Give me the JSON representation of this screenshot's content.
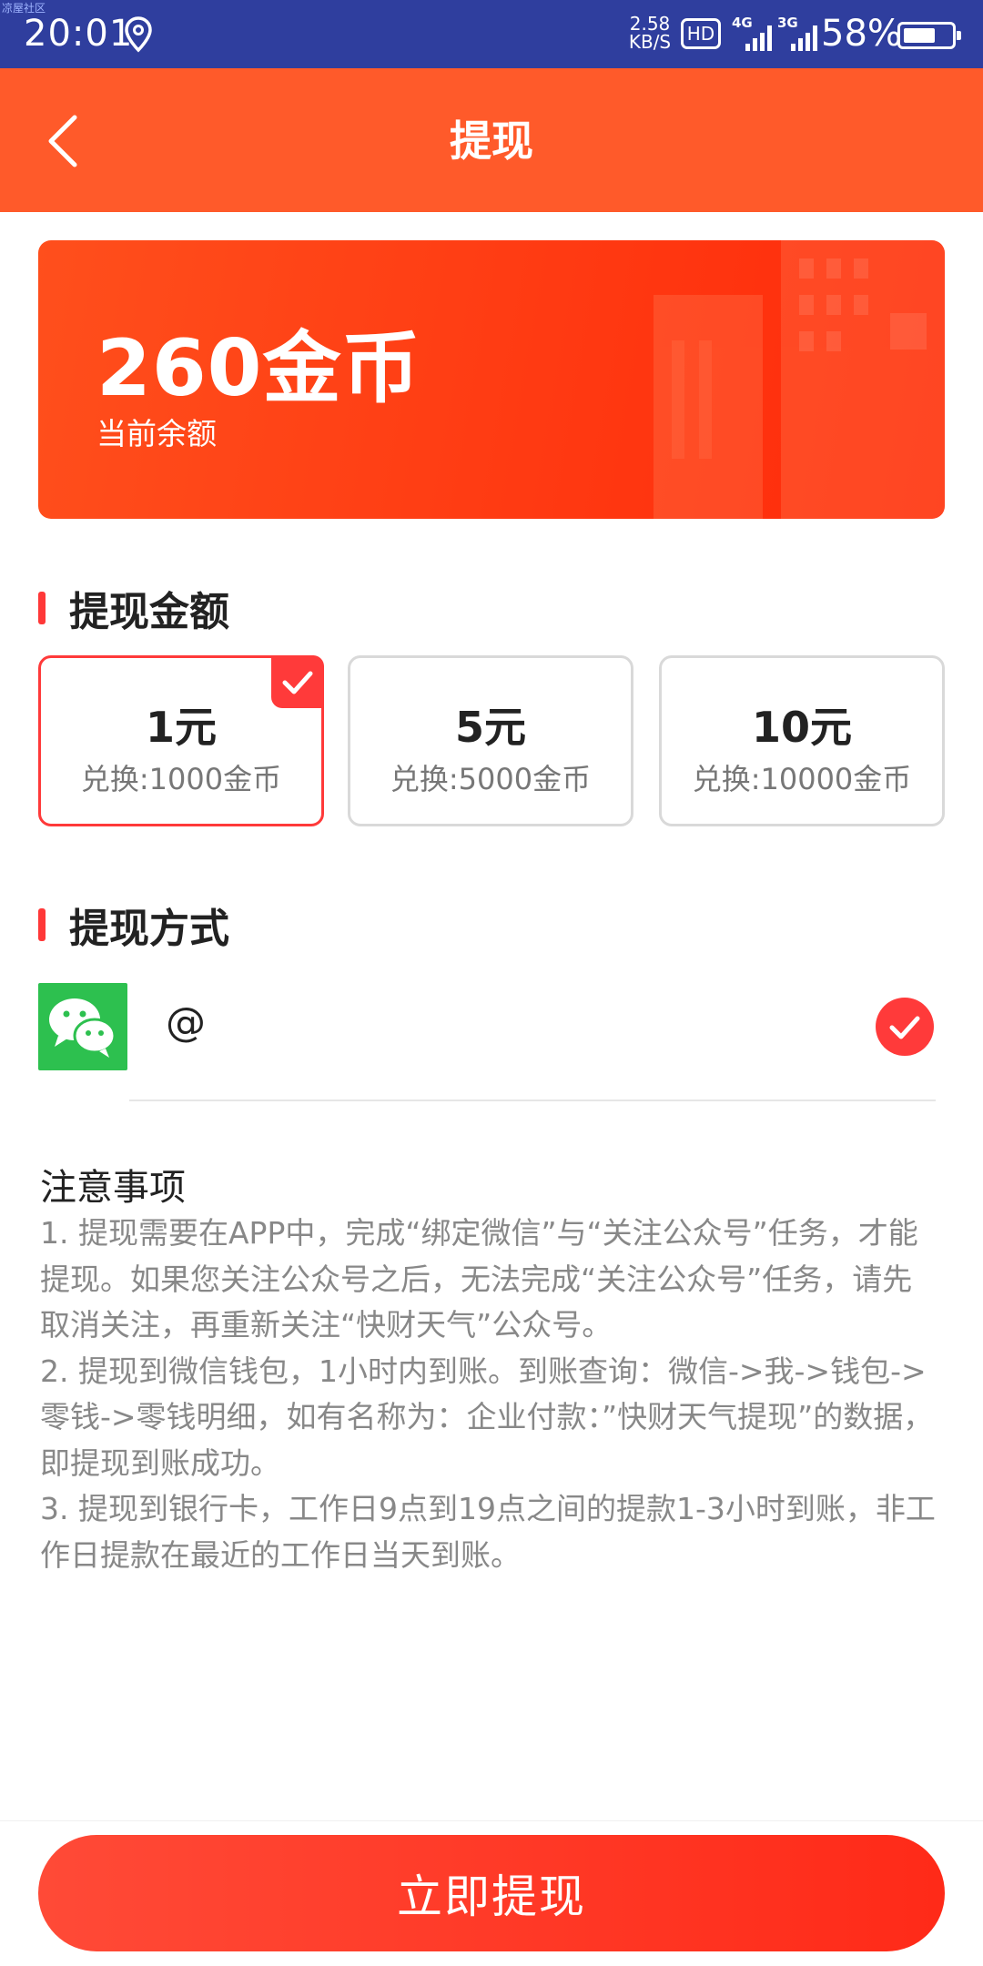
{
  "status_bar": {
    "watermark": "凉屋社区",
    "time": "20:01",
    "net_speed_value": "2.58",
    "net_speed_unit": "KB/S",
    "hd_label": "HD",
    "sim1_label": "4G",
    "sim2_label": "3G",
    "battery_percent": "58%",
    "battery_level": 0.58,
    "icons": [
      "location-icon",
      "signal-4g-icon",
      "signal-3g-icon",
      "battery-icon"
    ]
  },
  "header": {
    "title": "提现",
    "back_icon": "back-arrow-icon",
    "background_color": "#ff5a2a"
  },
  "balance": {
    "value": "260金币",
    "label": "当前余额"
  },
  "amount_section": {
    "title": "提现金额",
    "options": [
      {
        "main": "1元",
        "sub": "兑换:1000金币",
        "selected": true
      },
      {
        "main": "5元",
        "sub": "兑换:5000金币",
        "selected": false
      },
      {
        "main": "10元",
        "sub": "兑换:10000金币",
        "selected": false
      }
    ]
  },
  "method_section": {
    "title": "提现方式",
    "method_icon": "wechat-icon",
    "account": "@",
    "selected": true
  },
  "notes": {
    "title": "注意事项",
    "lines": [
      "1. 提现需要在APP中，完成“绑定微信”与“关注公众号”任务，才能提现。如果您关注公众号之后，无法完成“关注公众号”任务，请先取消关注，再重新关注“快财天气”公众号。",
      "2. 提现到微信钱包，1小时内到账。到账查询：微信->我->钱包->零钱->零钱明细，如有名称为：企业付款：”快财天气提现”的数据，即提现到账成功。",
      "3. 提现到银行卡，工作日9点到19点之间的提款1-3小时到账，非工作日提款在最近的工作日当天到账。"
    ]
  },
  "submit": {
    "label": "立即提现"
  },
  "colors": {
    "accent": "#ff3a3a",
    "status_bar": "#2f3e9e",
    "wechat": "#2dc04f"
  }
}
